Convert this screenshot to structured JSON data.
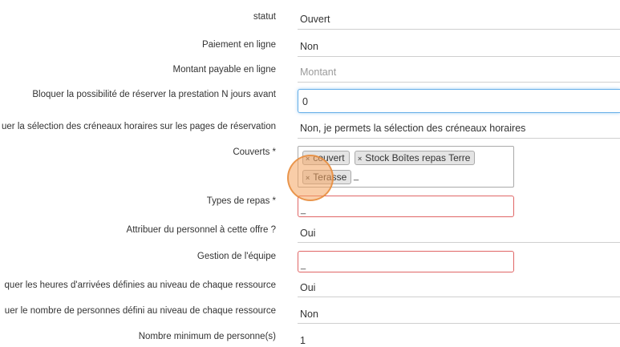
{
  "fields": {
    "statut": {
      "label": "statut",
      "value": "Ouvert"
    },
    "paiement": {
      "label": "Paiement en ligne",
      "value": "Non"
    },
    "montant": {
      "label": "Montant payable en ligne",
      "placeholder": "Montant"
    },
    "bloquer_jours": {
      "label": "Bloquer la possibilité de réserver la prestation N jours avant",
      "value": "0"
    },
    "creneaux": {
      "label": "uer la sélection des créneaux horaires sur les pages de réservation",
      "value": "Non, je permets la sélection des créneaux horaires"
    },
    "couverts": {
      "label": "Couverts *",
      "tags": [
        "couvert",
        "Stock Boîtes repas Terre",
        "Terasse"
      ],
      "remove_glyph": "×",
      "cursor": "_"
    },
    "types_repas": {
      "label": "Types de repas *",
      "cursor": "_"
    },
    "personnel": {
      "label": "Attribuer du personnel à cette offre ?",
      "value": "Oui"
    },
    "equipe": {
      "label": "Gestion de l'équipe",
      "cursor": "_"
    },
    "heures": {
      "label": "quer les heures d'arrivées définies au niveau de chaque ressource",
      "value": "Oui"
    },
    "nombre_personnes": {
      "label": "uer le nombre de personnes défini au niveau de chaque ressource",
      "value": "Non"
    },
    "nombre_min": {
      "label": "Nombre minimum de personne(s)",
      "value": "1"
    }
  },
  "colors": {
    "focus_border": "#66afe9",
    "error_border": "#e06666",
    "tag_bg": "#e4e4e4",
    "click_indicator": "#f4a460"
  }
}
